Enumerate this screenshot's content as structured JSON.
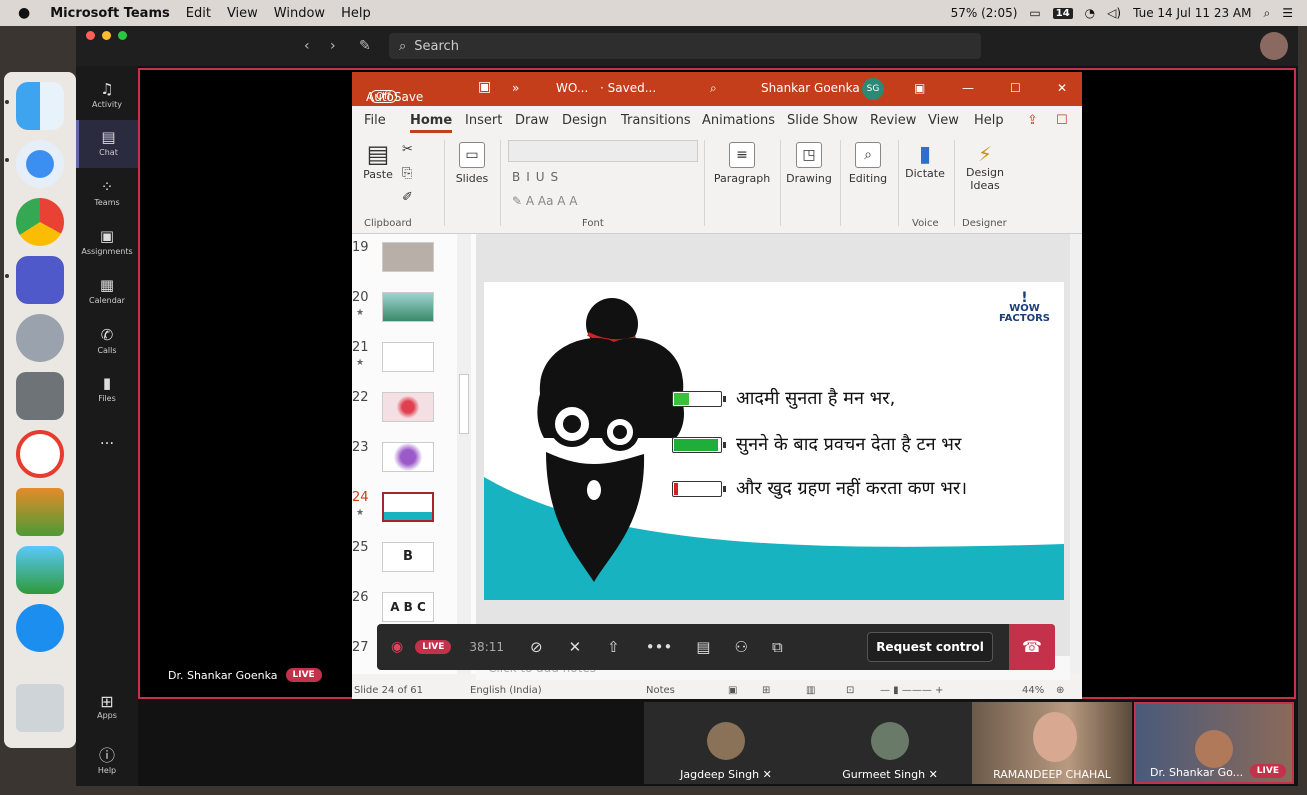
{
  "menubar": {
    "app": "Microsoft Teams",
    "items": [
      "Edit",
      "View",
      "Window",
      "Help"
    ],
    "battery": "57% (2:05)",
    "calendar_badge": "14",
    "datetime": "Tue 14 Jul  11 23 AM"
  },
  "teams": {
    "search_placeholder": "Search",
    "rail": [
      {
        "label": "Activity",
        "icon": "bell-icon"
      },
      {
        "label": "Chat",
        "icon": "chat-icon"
      },
      {
        "label": "Teams",
        "icon": "teams-icon"
      },
      {
        "label": "Assignments",
        "icon": "assignments-icon"
      },
      {
        "label": "Calendar",
        "icon": "calendar-icon"
      },
      {
        "label": "Calls",
        "icon": "phone-icon"
      },
      {
        "label": "Files",
        "icon": "file-icon"
      }
    ],
    "more": "...",
    "apps": "Apps",
    "help": "Help",
    "presenter_name": "Dr. Shankar Goenka",
    "live": "LIVE"
  },
  "ppt": {
    "autosave": "AutoSave",
    "autosave_state": "Off",
    "filename": "WO...",
    "saved": "· Saved...",
    "user": "Shankar Goenka",
    "user_initials": "SG",
    "tabs": [
      "File",
      "Home",
      "Insert",
      "Draw",
      "Design",
      "Transitions",
      "Animations",
      "Slide Show",
      "Review",
      "View",
      "Help"
    ],
    "active_tab": "Home",
    "ribbon": {
      "paste": "Paste",
      "slides": "Slides",
      "paragraph": "Paragraph",
      "drawing": "Drawing",
      "editing": "Editing",
      "dictate": "Dictate",
      "design_ideas_1": "Design",
      "design_ideas_2": "Ideas",
      "group_clipboard": "Clipboard",
      "group_font": "Font",
      "group_voice": "Voice",
      "group_designer": "Designer"
    },
    "thumbnails": [
      {
        "num": "19",
        "star": false,
        "text": ""
      },
      {
        "num": "20",
        "star": true,
        "text": ""
      },
      {
        "num": "21",
        "star": true,
        "text": ""
      },
      {
        "num": "22",
        "star": false,
        "text": ""
      },
      {
        "num": "23",
        "star": false,
        "text": ""
      },
      {
        "num": "24",
        "star": true,
        "text": ""
      },
      {
        "num": "25",
        "star": false,
        "text": "B"
      },
      {
        "num": "26",
        "star": false,
        "text": "A B C"
      },
      {
        "num": "27",
        "star": false,
        "text": ""
      }
    ],
    "slide": {
      "logo_main": "WOW",
      "logo_sub": "FACTORS",
      "lines": [
        {
          "text": "आदमी सुनता है मन भर,",
          "level": 0.35,
          "color": "#3cbf3c"
        },
        {
          "text": "सुनने के बाद प्रवचन देता है टन भर",
          "level": 1.0,
          "color": "#1fae3a"
        },
        {
          "text": "और खुद ग्रहण नहीं करता कण भर।",
          "level": 0.08,
          "color": "#d42020"
        }
      ]
    },
    "notes_placeholder": "Click to add notes",
    "status": {
      "slide": "Slide 24 of 61",
      "language": "English (India)",
      "notes": "Notes",
      "zoom": "44%"
    }
  },
  "callbar": {
    "live": "LIVE",
    "timer": "38:11",
    "request_control": "Request control"
  },
  "participants": [
    {
      "name": "Jagdeep Singh"
    },
    {
      "name": "Gurmeet Singh"
    },
    {
      "name": "RAMANDEEP CHAHAL"
    },
    {
      "name": "Dr. Shankar Go...",
      "live": "LIVE"
    }
  ],
  "colors": {
    "ppt_accent": "#c43e1c",
    "teams_accent": "#6264a7",
    "live_red": "#c4314b",
    "slide_teal": "#17b3c1"
  }
}
